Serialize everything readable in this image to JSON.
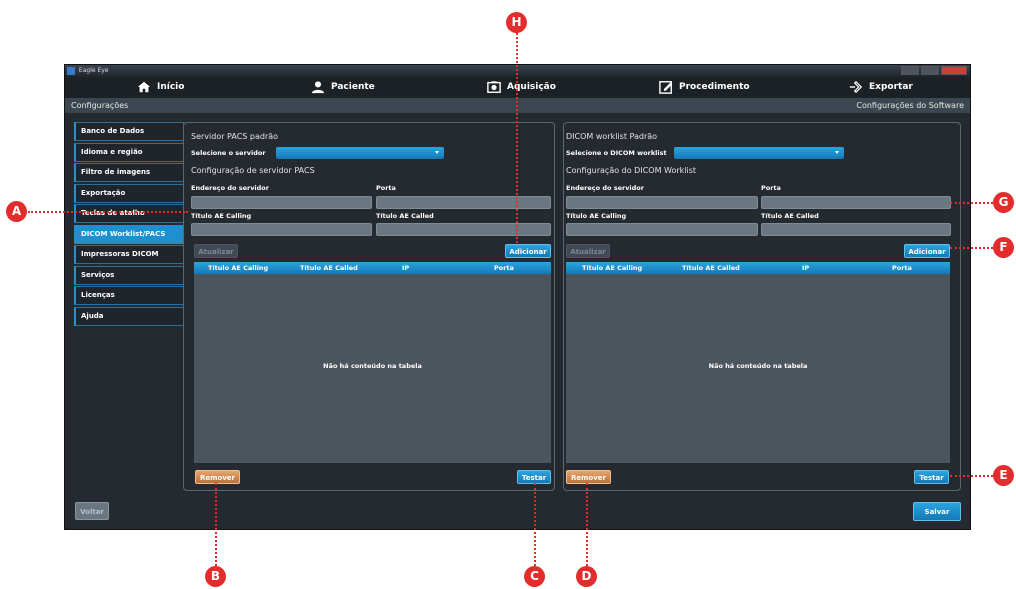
{
  "window": {
    "title": "Eagle Eye"
  },
  "topnav": [
    {
      "label": "Início",
      "icon": "home-icon"
    },
    {
      "label": "Paciente",
      "icon": "user-icon"
    },
    {
      "label": "Aquisição",
      "icon": "camera-icon"
    },
    {
      "label": "Procedimento",
      "icon": "edit-icon"
    },
    {
      "label": "Exportar",
      "icon": "export-arrow-icon"
    }
  ],
  "header": {
    "left": "Configurações",
    "right": "Configurações do Software"
  },
  "sidebar": {
    "items": [
      {
        "label": "Banco de Dados"
      },
      {
        "label": "Idioma e região"
      },
      {
        "label": "Filtro de imagens"
      },
      {
        "label": "Exportação"
      },
      {
        "label": "Teclas de atalho"
      },
      {
        "label": "DICOM Worklist/PACS",
        "active": true
      },
      {
        "label": "Impressoras DICOM"
      },
      {
        "label": "Serviços"
      },
      {
        "label": "Licenças"
      },
      {
        "label": "Ajuda"
      }
    ]
  },
  "pacs": {
    "title": "Servidor PACS padrão",
    "select_label": "Selecione o servidor",
    "config_title": "Configuração de servidor PACS",
    "address_label": "Endereço do servidor",
    "port_label": "Porta",
    "calling_label": "Título AE Calling",
    "called_label": "Título AE Called",
    "update_button": "Atualizar",
    "add_button": "Adicionar",
    "columns": [
      "Título AE Calling",
      "Título AE Called",
      "IP",
      "Porta"
    ],
    "empty_text": "Não há conteúdo na tabela",
    "remove_button": "Remover",
    "test_button": "Testar"
  },
  "worklist": {
    "title": "DICOM worklist Padrão",
    "select_label": "Selecione o DICOM worklist",
    "config_title": "Configuração do DICOM Worklist",
    "address_label": "Endereço do servidor",
    "port_label": "Porta",
    "calling_label": "Título AE Calling",
    "called_label": "Título AE Called",
    "update_button": "Atualizar",
    "add_button": "Adicionar",
    "columns": [
      "Título AE Calling",
      "Título AE Called",
      "IP",
      "Porta"
    ],
    "empty_text": "Não há conteúdo na tabela",
    "remove_button": "Remover",
    "test_button": "Testar"
  },
  "footer": {
    "back_button": "Voltar",
    "save_button": "Salvar"
  },
  "callouts": [
    "A",
    "B",
    "C",
    "D",
    "E",
    "F",
    "G",
    "H"
  ],
  "colors": {
    "accent": "#1e8fcf",
    "callout": "#e32c2c",
    "remove": "#c97e45"
  }
}
